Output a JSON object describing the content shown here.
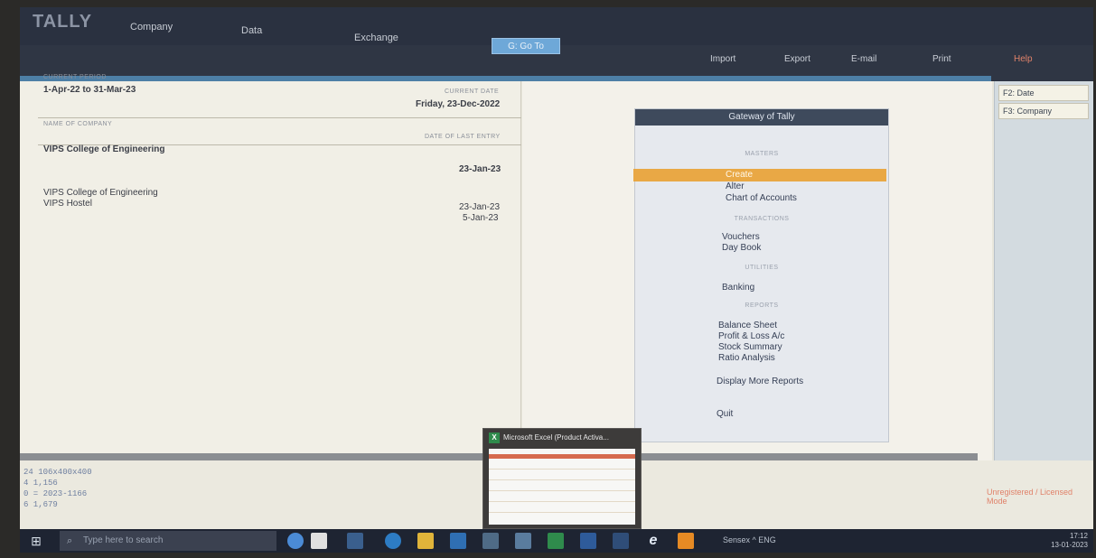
{
  "topbar": {
    "logo": "TALLY",
    "menus": [
      "Company",
      "Data",
      "Exchange"
    ],
    "goto": "G: Go To"
  },
  "subbar": {
    "items": [
      "Import",
      "Export",
      "E-mail",
      "Print"
    ],
    "help": "Help"
  },
  "left": {
    "period_label": "CURRENT PERIOD",
    "period": "1-Apr-22 to 31-Mar-23",
    "date_label": "CURRENT DATE",
    "date": "Friday, 23-Dec-2022",
    "company_label": "NAME OF COMPANY",
    "last_entry_label": "DATE OF LAST ENTRY",
    "active_company": "VIPS College of Engineering",
    "active_last_entry": "23-Jan-23",
    "companies": [
      {
        "name": "VIPS College of Engineering",
        "date": "23-Jan-23"
      },
      {
        "name": "VIPS Hostel",
        "date": "5-Jan-23"
      }
    ]
  },
  "gateway": {
    "title": "Gateway of Tally",
    "sections": {
      "masters": "MASTERS",
      "transactions": "TRANSACTIONS",
      "utilities": "UTILITIES",
      "reports": "REPORTS"
    },
    "masters_items": [
      "Create",
      "Alter",
      "Chart of Accounts"
    ],
    "transactions_items": [
      "Vouchers",
      "Day Book"
    ],
    "utilities_items": [
      "Banking"
    ],
    "reports_items": [
      "Balance Sheet",
      "Profit & Loss A/c",
      "Stock Summary",
      "Ratio Analysis"
    ],
    "more": "Display More Reports",
    "quit": "Quit"
  },
  "right_side": {
    "buttons": [
      "F2: Date",
      "F3: Company"
    ]
  },
  "console": {
    "lines": [
      "24   106x400x400",
      "4    1,156",
      "0   = 2023-1166",
      "6    1,679"
    ]
  },
  "status_note": "Unregistered / Licensed Mode",
  "excel_preview": {
    "title": "Microsoft Excel (Product Activa..."
  },
  "taskbar": {
    "search_placeholder": "Type here to search",
    "tray_time": "17:12",
    "tray_date": "13-01-2023",
    "tray_icons": "Sensex   ^  ENG"
  },
  "colors": {
    "accent_highlight": "#e9a845",
    "topbar": "#2a3140",
    "gateway_title": "#3e4a5c"
  }
}
